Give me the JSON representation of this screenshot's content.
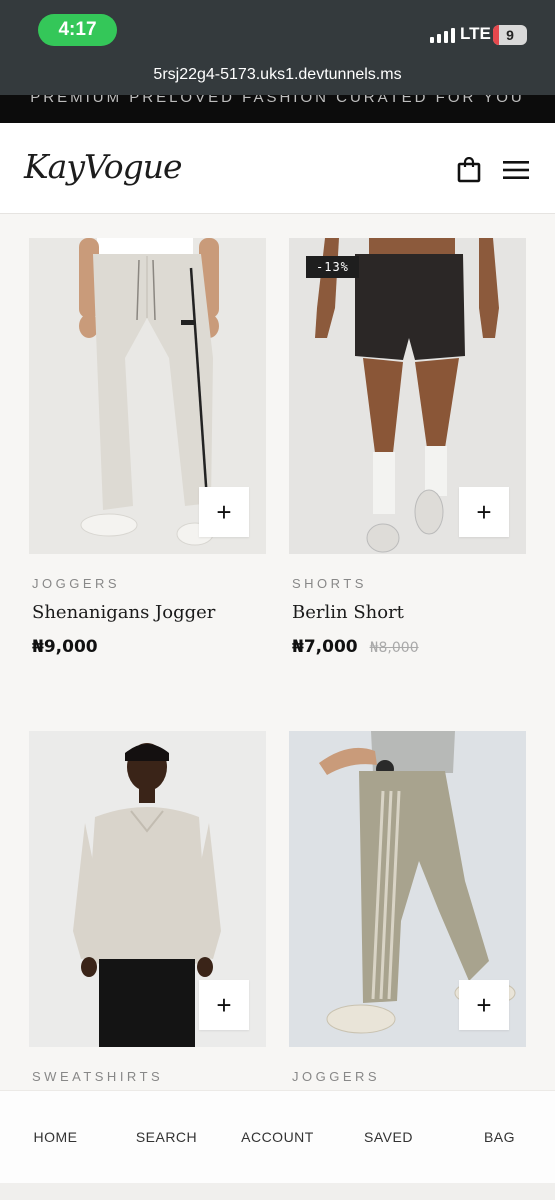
{
  "status_bar": {
    "time": "4:17",
    "network": "LTE",
    "battery": "9",
    "url": "5rsj22g4-5173.uks1.devtunnels.ms"
  },
  "announcement": "PREMIUM PRELOVED FASHION CURATED FOR YOU",
  "header": {
    "logo": "KayVogue",
    "icons": [
      "shopping-bag-icon",
      "menu-icon"
    ]
  },
  "products": [
    {
      "category": "JOGGERS",
      "name": "Shenanigans Jogger",
      "price": "₦9,000",
      "old_price": "",
      "badge": "",
      "add_label": "+"
    },
    {
      "category": "SHORTS",
      "name": "Berlin Short",
      "price": "₦7,000",
      "old_price": "₦8,000",
      "badge": "-13%",
      "add_label": "+"
    },
    {
      "category": "SWEATSHIRTS",
      "name": "",
      "price": "",
      "old_price": "",
      "badge": "",
      "add_label": "+"
    },
    {
      "category": "JOGGERS",
      "name": "",
      "price": "",
      "old_price": "",
      "badge": "",
      "add_label": "+"
    }
  ],
  "bottom_nav": [
    "HOME",
    "SEARCH",
    "ACCOUNT",
    "SAVED",
    "BAG"
  ],
  "colors": {
    "status_bg": "#343a3d",
    "time_pill": "#34c759",
    "announce_bg": "#0c0c0c",
    "page_bg": "#f7f6f4",
    "accent": "#111111"
  }
}
